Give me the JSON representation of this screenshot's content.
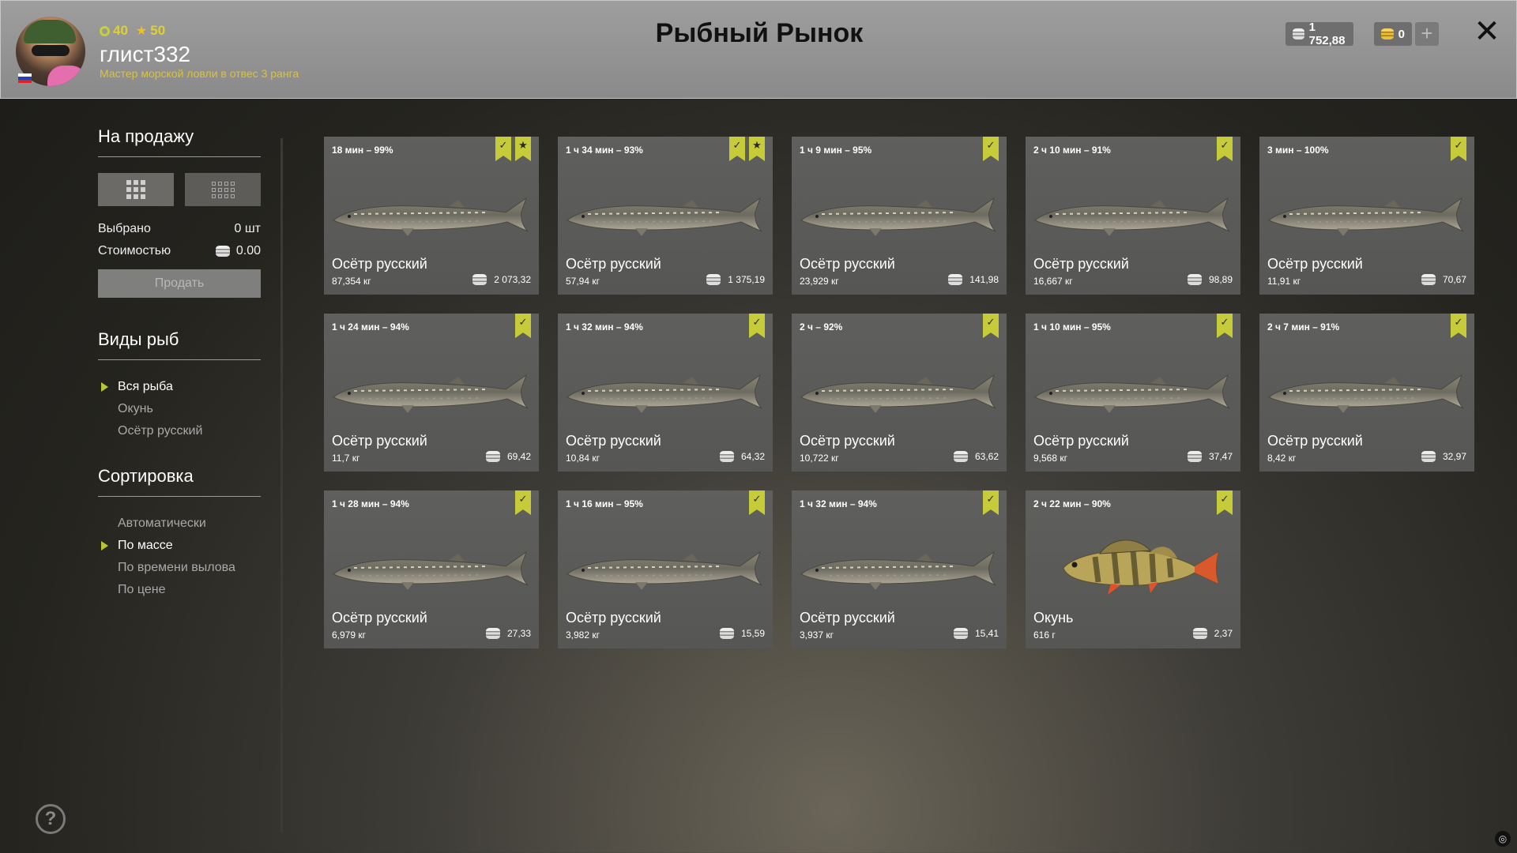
{
  "header": {
    "player": {
      "stat_1": "40",
      "stat_2": "50",
      "username": "глист332",
      "rank": "Мастер морской ловли в отвес 3 ранга"
    },
    "title": "Рыбный Рынок",
    "silver": "1 752,88",
    "gold": "0",
    "add_icon": "plus-icon",
    "close_icon": "close-icon"
  },
  "sidebar": {
    "for_sale": {
      "title": "На продажу",
      "selected_label": "Выбрано",
      "selected_value": "0 шт",
      "cost_label": "Стоимостью",
      "cost_value": "0.00",
      "sell_button": "Продать"
    },
    "fish_types": {
      "title": "Виды рыб",
      "items": [
        {
          "label": "Вся рыба",
          "active": true
        },
        {
          "label": "Окунь",
          "active": false
        },
        {
          "label": "Осётр русский",
          "active": false
        }
      ]
    },
    "sorting": {
      "title": "Сортировка",
      "items": [
        {
          "label": "Автоматически",
          "active": false
        },
        {
          "label": "По массе",
          "active": true
        },
        {
          "label": "По времени вылова",
          "active": false
        },
        {
          "label": "По цене",
          "active": false
        }
      ]
    }
  },
  "fish": [
    {
      "time": "18 мин – 99%",
      "name": "Осётр русский",
      "weight": "87,354 кг",
      "price": "2 073,32",
      "check": true,
      "star": true,
      "species": "sturgeon"
    },
    {
      "time": "1 ч 34 мин – 93%",
      "name": "Осётр русский",
      "weight": "57,94 кг",
      "price": "1 375,19",
      "check": true,
      "star": true,
      "species": "sturgeon"
    },
    {
      "time": "1 ч 9 мин – 95%",
      "name": "Осётр русский",
      "weight": "23,929 кг",
      "price": "141,98",
      "check": true,
      "star": false,
      "species": "sturgeon"
    },
    {
      "time": "2 ч 10 мин – 91%",
      "name": "Осётр русский",
      "weight": "16,667 кг",
      "price": "98,89",
      "check": true,
      "star": false,
      "species": "sturgeon"
    },
    {
      "time": "3 мин – 100%",
      "name": "Осётр русский",
      "weight": "11,91 кг",
      "price": "70,67",
      "check": true,
      "star": false,
      "species": "sturgeon"
    },
    {
      "time": "1 ч 24 мин – 94%",
      "name": "Осётр русский",
      "weight": "11,7 кг",
      "price": "69,42",
      "check": true,
      "star": false,
      "species": "sturgeon"
    },
    {
      "time": "1 ч 32 мин – 94%",
      "name": "Осётр русский",
      "weight": "10,84 кг",
      "price": "64,32",
      "check": true,
      "star": false,
      "species": "sturgeon"
    },
    {
      "time": "2 ч – 92%",
      "name": "Осётр русский",
      "weight": "10,722 кг",
      "price": "63,62",
      "check": true,
      "star": false,
      "species": "sturgeon"
    },
    {
      "time": "1 ч 10 мин – 95%",
      "name": "Осётр русский",
      "weight": "9,568 кг",
      "price": "37,47",
      "check": true,
      "star": false,
      "species": "sturgeon"
    },
    {
      "time": "2 ч 7 мин – 91%",
      "name": "Осётр русский",
      "weight": "8,42 кг",
      "price": "32,97",
      "check": true,
      "star": false,
      "species": "sturgeon"
    },
    {
      "time": "1 ч 28 мин – 94%",
      "name": "Осётр русский",
      "weight": "6,979 кг",
      "price": "27,33",
      "check": true,
      "star": false,
      "species": "sturgeon"
    },
    {
      "time": "1 ч 16 мин – 95%",
      "name": "Осётр русский",
      "weight": "3,982 кг",
      "price": "15,59",
      "check": true,
      "star": false,
      "species": "sturgeon"
    },
    {
      "time": "1 ч 32 мин – 94%",
      "name": "Осётр русский",
      "weight": "3,937 кг",
      "price": "15,41",
      "check": true,
      "star": false,
      "species": "sturgeon"
    },
    {
      "time": "2 ч 22 мин – 90%",
      "name": "Окунь",
      "weight": "616 г",
      "price": "2,37",
      "check": true,
      "star": false,
      "species": "perch"
    }
  ],
  "colors": {
    "accent": "#c6cb3a",
    "rank_text": "#d9c43a"
  }
}
